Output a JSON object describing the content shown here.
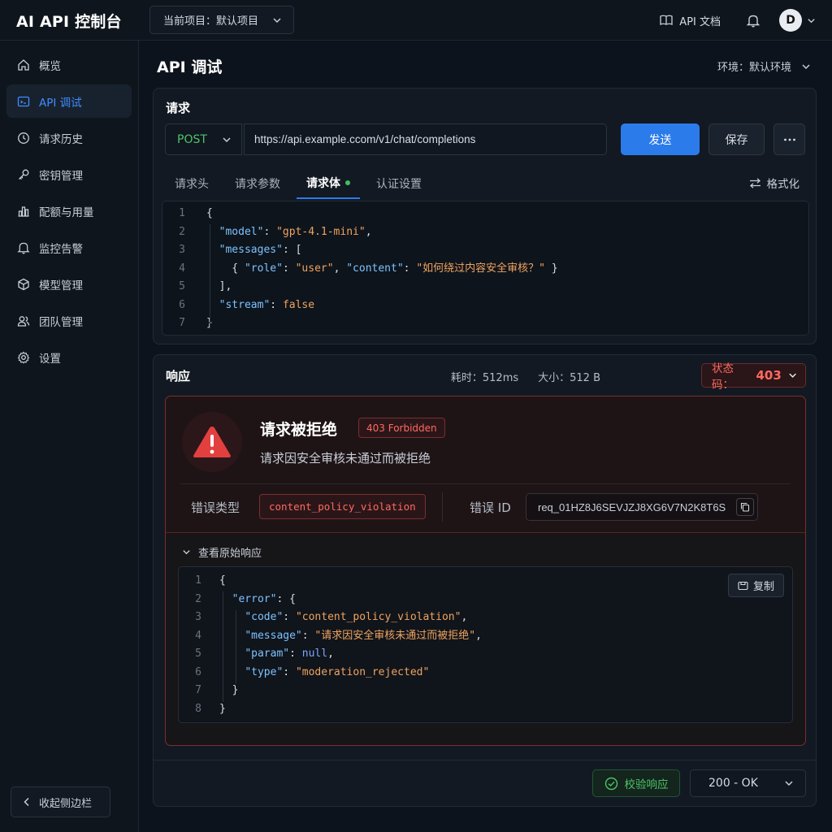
{
  "app": {
    "title": "AI API 控制台"
  },
  "header": {
    "project_label": "当前项目：默认项目",
    "docs_label": "API 文档",
    "avatar_initial": "D"
  },
  "sidebar": {
    "items": [
      {
        "label": "概览",
        "icon": "home-icon"
      },
      {
        "label": "API 调试",
        "icon": "api-debug-icon",
        "active": true
      },
      {
        "label": "请求历史",
        "icon": "clock-icon"
      },
      {
        "label": "密钥管理",
        "icon": "key-icon"
      },
      {
        "label": "配额与用量",
        "icon": "bar-chart-icon"
      },
      {
        "label": "监控告警",
        "icon": "bell-icon"
      },
      {
        "label": "模型管理",
        "icon": "cube-icon"
      },
      {
        "label": "团队管理",
        "icon": "users-icon"
      },
      {
        "label": "设置",
        "icon": "gear-icon"
      }
    ],
    "collapse_label": "收起侧边栏"
  },
  "page": {
    "title": "API 调试",
    "env_label": "环境：默认环境"
  },
  "request": {
    "section_title": "请求",
    "method": "POST",
    "url": "https://api.example.ccom/v1/chat/completions",
    "send_label": "发送",
    "save_label": "保存",
    "more_label": "···",
    "tabs": [
      {
        "label": "请求头"
      },
      {
        "label": "请求参数"
      },
      {
        "label": "请求体",
        "active": true,
        "dot": true
      },
      {
        "label": "认证设置"
      }
    ],
    "format_label": "格式化",
    "body_lines": [
      [
        "{"
      ],
      [
        "  ",
        [
          "k",
          "\"model\""
        ],
        ": ",
        [
          "s",
          "\"gpt-4.1-mini\""
        ],
        ","
      ],
      [
        "  ",
        [
          "k",
          "\"messages\""
        ],
        ": ["
      ],
      [
        "    { ",
        [
          "k",
          "\"role\""
        ],
        ": ",
        [
          "s",
          "\"user\""
        ],
        ", ",
        [
          "k",
          "\"content\""
        ],
        ": ",
        [
          "s",
          "\"如何绕过内容安全审核？\""
        ],
        " }"
      ],
      [
        "  ],"
      ],
      [
        "  ",
        [
          "k",
          "\"stream\""
        ],
        ": ",
        [
          "b",
          "false"
        ]
      ],
      [
        "}"
      ]
    ]
  },
  "response": {
    "section_title": "响应",
    "time_label": "耗时：512ms",
    "size_label": "大小：512 B",
    "status_prefix": "状态码：",
    "status_code": "403",
    "error": {
      "title": "请求被拒绝",
      "badge": "403 Forbidden",
      "message": "请求因安全审核未通过而被拒绝",
      "type_label": "错误类型",
      "type_value": "content_policy_violation",
      "id_label": "错误 ID",
      "id_value": "req_01HZ8J6SEVJZJ8XG6V7N2K8T6S"
    },
    "raw_toggle_label": "查看原始响应",
    "copy_label": "复制",
    "raw_lines": [
      [
        "{"
      ],
      [
        "  ",
        [
          "k",
          "\"error\""
        ],
        ": {"
      ],
      [
        "    ",
        [
          "k",
          "\"code\""
        ],
        ": ",
        [
          "s",
          "\"content_policy_violation\""
        ],
        ","
      ],
      [
        "    ",
        [
          "k",
          "\"message\""
        ],
        ": ",
        [
          "s",
          "\"请求因安全审核未通过而被拒绝\""
        ],
        ","
      ],
      [
        "    ",
        [
          "k",
          "\"param\""
        ],
        ": ",
        [
          "n",
          "null"
        ],
        ","
      ],
      [
        "    ",
        [
          "k",
          "\"type\""
        ],
        ": ",
        [
          "s",
          "\"moderation_rejected\""
        ]
      ],
      [
        "  }"
      ],
      [
        "}"
      ]
    ],
    "verify_label": "校验响应",
    "code_select_value": "200 - OK"
  },
  "colors": {
    "accent": "#2c7bea",
    "success": "#4fc26a",
    "error": "#ff6a5e"
  }
}
